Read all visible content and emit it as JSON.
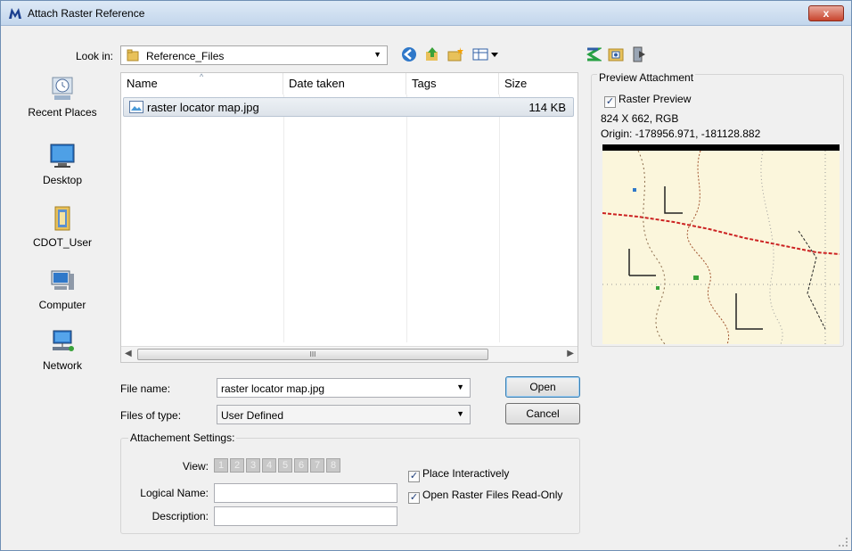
{
  "window": {
    "title": "Attach Raster Reference",
    "close_label": "x"
  },
  "lookin": {
    "label": "Look in:",
    "value": "Reference_Files"
  },
  "places": [
    {
      "label": "Recent Places",
      "icon": "recent-places-icon"
    },
    {
      "label": "Desktop",
      "icon": "desktop-icon"
    },
    {
      "label": "CDOT_User",
      "icon": "user-folder-icon"
    },
    {
      "label": "Computer",
      "icon": "computer-icon"
    },
    {
      "label": "Network",
      "icon": "network-icon"
    }
  ],
  "filelist": {
    "columns": [
      "Name",
      "Date taken",
      "Tags",
      "Size"
    ],
    "rows": [
      {
        "name": "raster locator map.jpg",
        "date": "",
        "tags": "",
        "size": "114 KB"
      }
    ],
    "scroll_thumb": "III"
  },
  "preview": {
    "legend": "Preview Attachment",
    "raster_preview_label": "Raster Preview",
    "raster_preview_checked": true,
    "dimensions": "824 X 662, RGB",
    "origin": "Origin: -178956.971, -181128.882"
  },
  "filename": {
    "label": "File name:",
    "value": "raster locator map.jpg"
  },
  "filetype": {
    "label": "Files of type:",
    "value": "User Defined"
  },
  "buttons": {
    "open": "Open",
    "cancel": "Cancel"
  },
  "settings": {
    "legend": "Attachement Settings:",
    "view_label": "View:",
    "views": [
      "1",
      "2",
      "3",
      "4",
      "5",
      "6",
      "7",
      "8"
    ],
    "logical_name_label": "Logical Name:",
    "logical_name_value": "",
    "description_label": "Description:",
    "description_value": "",
    "place_interactively_label": "Place Interactively",
    "place_interactively_checked": true,
    "read_only_label": "Open Raster Files Read-Only",
    "read_only_checked": true
  }
}
